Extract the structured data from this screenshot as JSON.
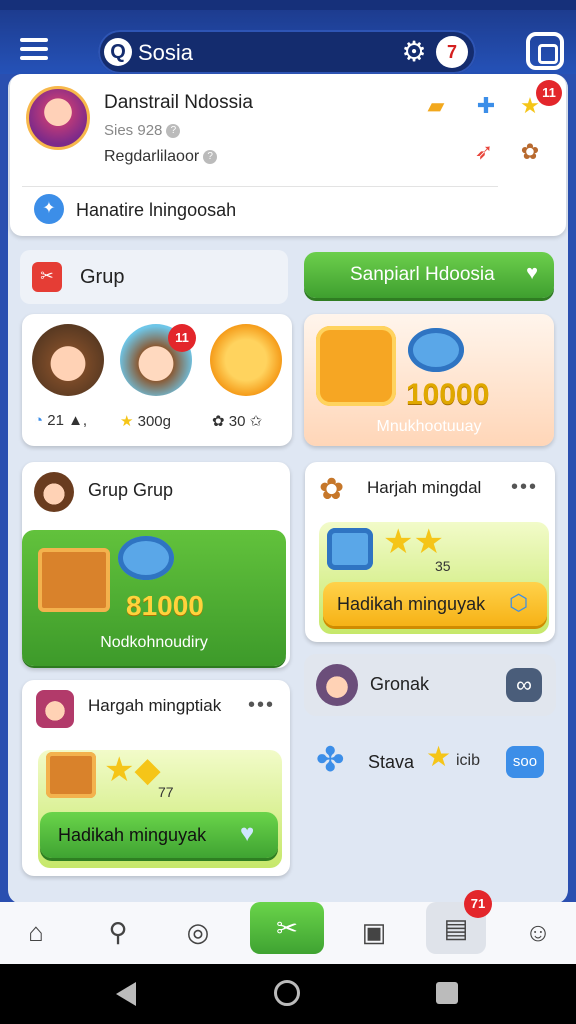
{
  "header": {
    "search_text": "Sosia",
    "notification_count": "7"
  },
  "profile": {
    "name": "Danstrail Ndossia",
    "sub": "Sies 928",
    "sub2": "Regdarlilaoor",
    "banner_text": "Hanatire lningoosah",
    "badge_count": "11"
  },
  "grup": {
    "label": "Grup"
  },
  "green_button": {
    "label": "Sanpiarl Hdoosia",
    "icon": "check-heart"
  },
  "avatars_card": {
    "badge": "11",
    "stats": [
      "21",
      "300g",
      "30"
    ]
  },
  "peach_card": {
    "coins": "10000",
    "label": "Mnukhootuuay"
  },
  "grup_grup": {
    "title": "Grup Grup",
    "coins": "81000",
    "label": "Nodkohnoudiry"
  },
  "hm_card1": {
    "title": "Harjah mingdal",
    "menu": "•••",
    "stars": "35",
    "button": "Hadikah minguyak"
  },
  "hm_card2": {
    "title": "Hargah mingptiak",
    "menu": "•••",
    "stars": "77",
    "button": "Hadikah minguyak"
  },
  "gronak": {
    "label": "Gronak",
    "btn": "∞"
  },
  "stava": {
    "label": "Stava",
    "extra": "icib",
    "btn": "soo"
  },
  "bottom_nav": {
    "badge": "71"
  },
  "colors": {
    "accent_blue": "#2552b8",
    "green": "#4fb33a",
    "orange": "#f6b216",
    "red": "#e3262b"
  }
}
